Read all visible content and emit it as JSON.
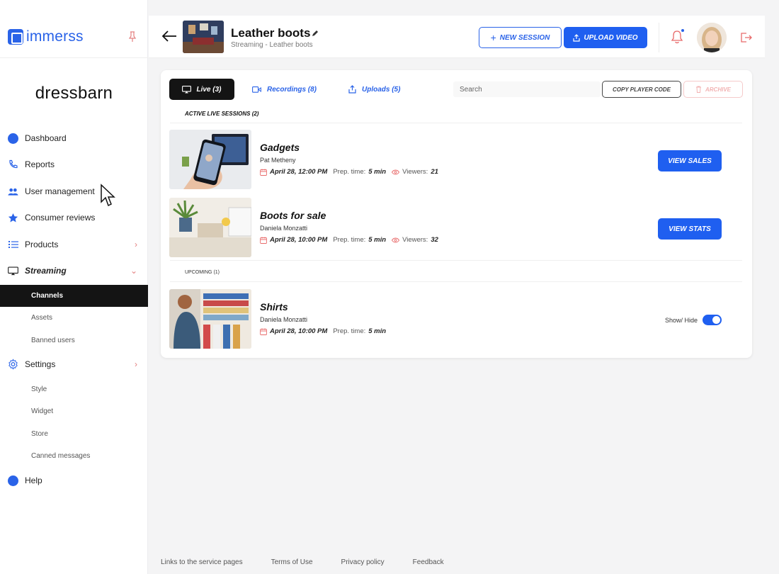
{
  "app": {
    "logo_text": "immerss",
    "brand_name": "dressbarn"
  },
  "sidebar": {
    "items": [
      {
        "label": "Dashboard"
      },
      {
        "label": "Reports"
      },
      {
        "label": "User management"
      },
      {
        "label": "Consumer reviews"
      },
      {
        "label": "Products"
      },
      {
        "label": "Streaming"
      },
      {
        "label": "Settings"
      },
      {
        "label": "Help"
      }
    ],
    "streaming_sub": [
      {
        "label": "Channels"
      },
      {
        "label": "Assets"
      },
      {
        "label": "Banned users"
      }
    ],
    "settings_sub": [
      {
        "label": "Style"
      },
      {
        "label": "Widget"
      },
      {
        "label": "Store"
      },
      {
        "label": "Canned messages"
      }
    ]
  },
  "header": {
    "title": "Leather boots",
    "subtitle": "Streaming - Leather boots",
    "new_session_label": "NEW SESSION",
    "upload_video_label": "UPLOAD VIDEO"
  },
  "tabs": {
    "live": "Live (3)",
    "recordings": "Recordings (8)",
    "uploads": "Uploads (5)"
  },
  "search": {
    "placeholder": "Search"
  },
  "actions": {
    "copy_player_code": "COPY PLAYER CODE",
    "archive": "ARCHIVE"
  },
  "sections": {
    "active": "ACTIVE LIVE SESSIONS  (2)",
    "upcoming": "UPCOMING (1)"
  },
  "sessions": [
    {
      "title": "Gadgets",
      "author": "Pat Metheny",
      "date": "April 28, 12:00 PM",
      "prep_label": "Prep. time:",
      "prep_value": "5 min",
      "viewers_label": "Viewers:",
      "viewers_value": "21",
      "action": "VIEW SALES"
    },
    {
      "title": "Boots for sale",
      "author": "Daniela Monzatti",
      "date": "April 28, 10:00 PM",
      "prep_label": "Prep. time:",
      "prep_value": "5 min",
      "viewers_label": "Viewers:",
      "viewers_value": "32",
      "action": "VIEW STATS"
    },
    {
      "title": "Shirts",
      "author": "Daniela Monzatti",
      "date": "April 28, 10:00 PM",
      "prep_label": "Prep. time:",
      "prep_value": "5 min",
      "toggle_label": "Show/ Hide"
    }
  ],
  "footer": {
    "links": [
      "Links to the service pages",
      "Terms of Use",
      "Privacy policy",
      "Feedback"
    ]
  },
  "colors": {
    "accent": "#1f5ff0",
    "dark": "#141414",
    "danger_light": "#f2b3b3"
  }
}
